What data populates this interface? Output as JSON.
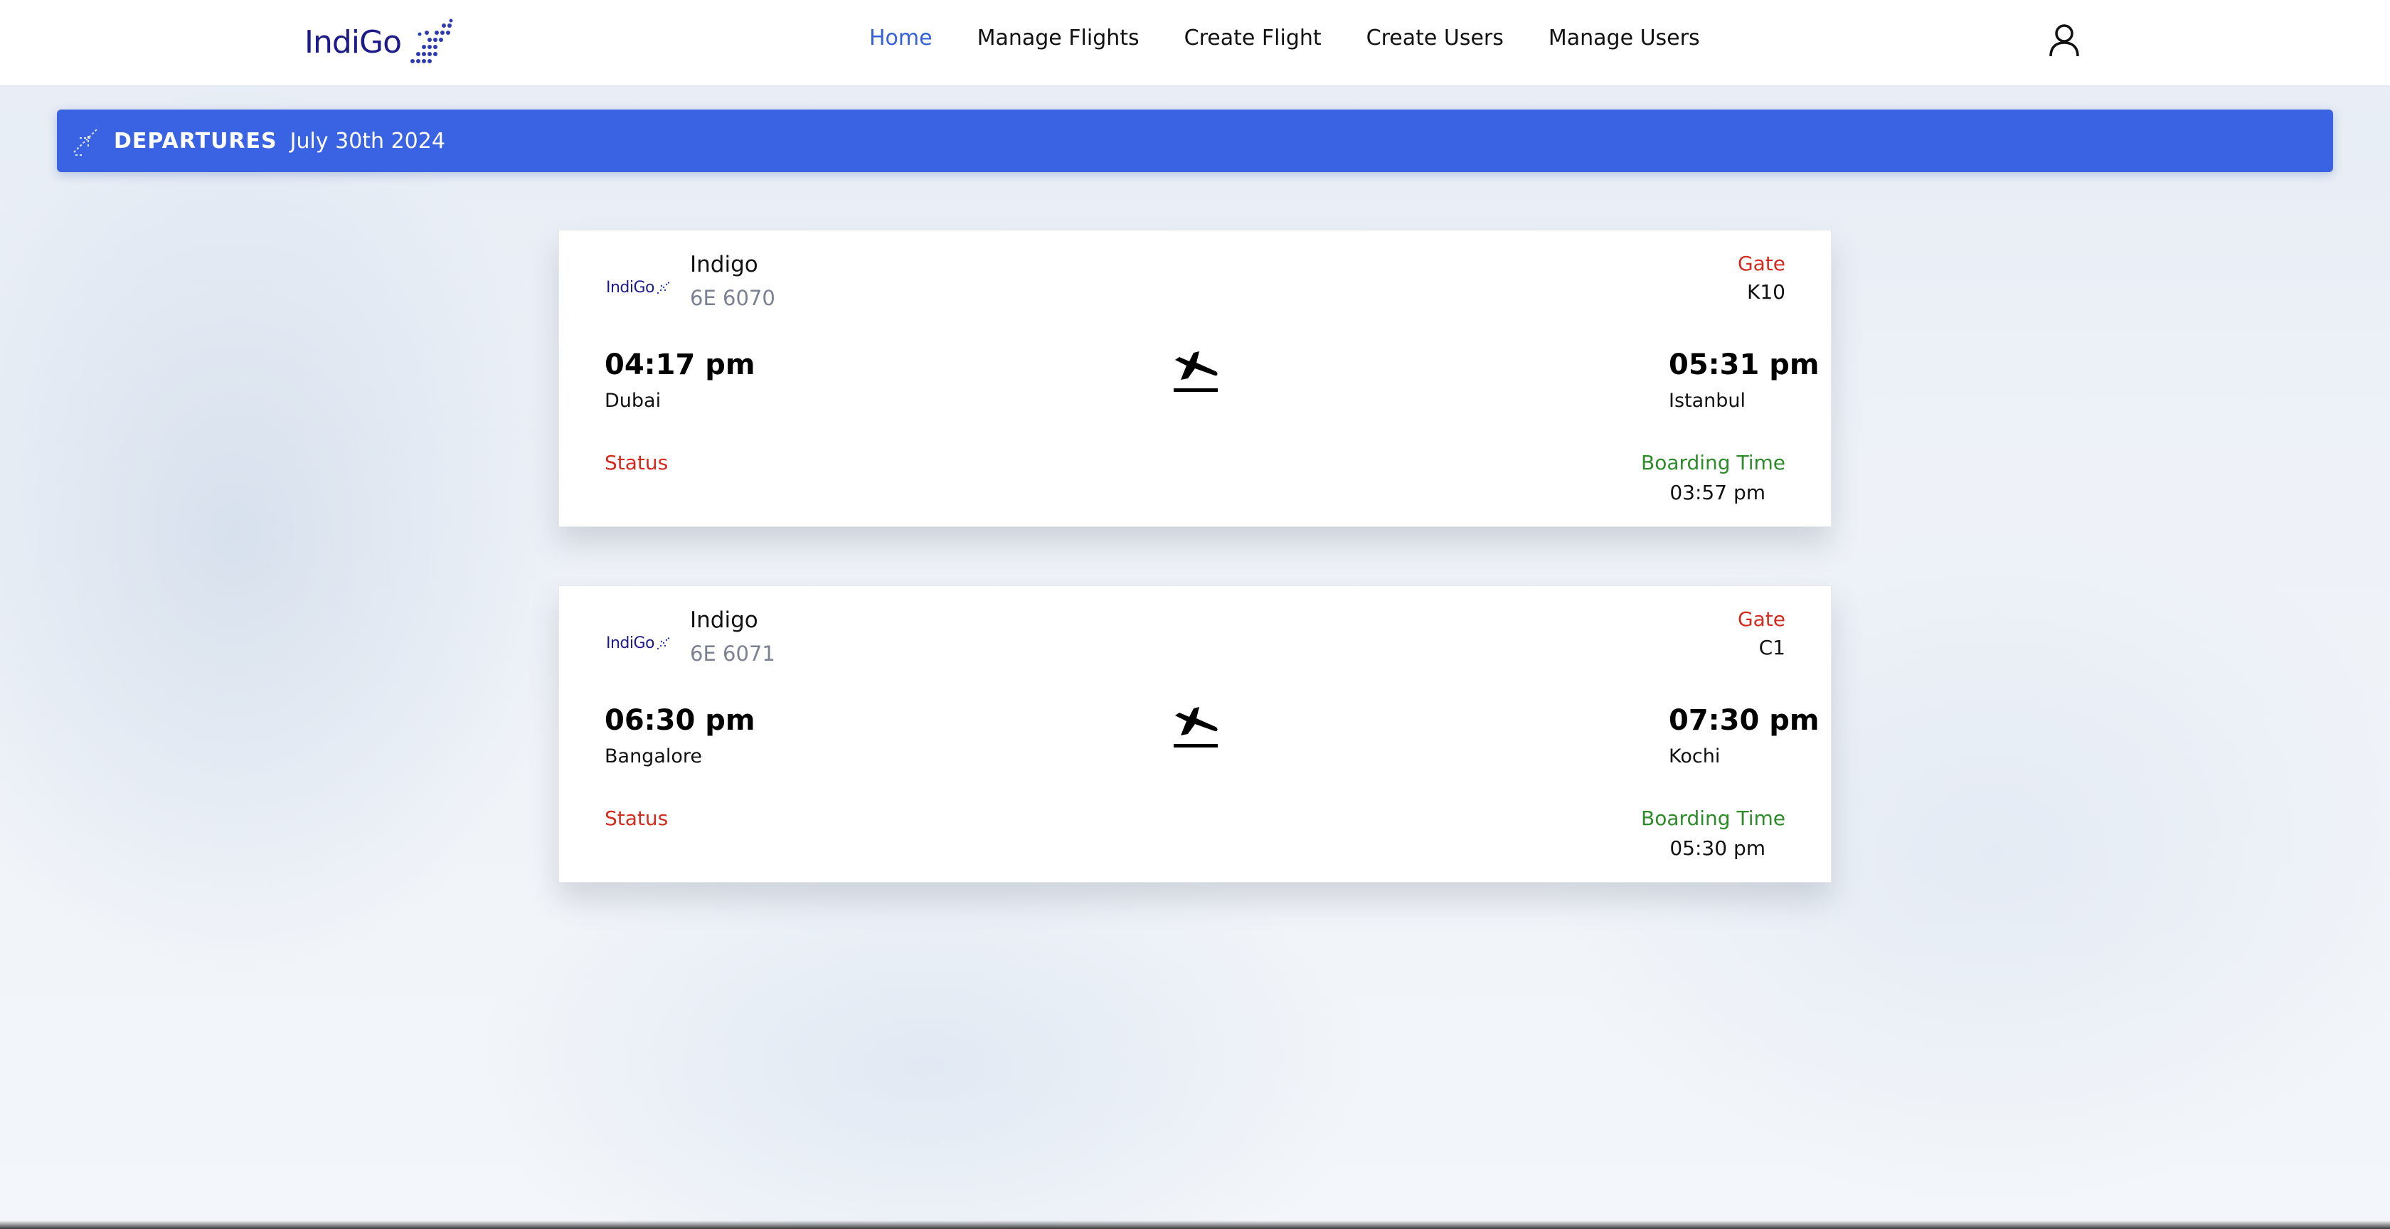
{
  "navbar": {
    "logo_text": "IndiGo",
    "links": [
      {
        "label": "Home",
        "active": true
      },
      {
        "label": "Manage Flights",
        "active": false
      },
      {
        "label": "Create Flight",
        "active": false
      },
      {
        "label": "Create Users",
        "active": false
      },
      {
        "label": "Manage Users",
        "active": false
      }
    ],
    "user_icon": "user-icon"
  },
  "banner": {
    "icon": "takeoff-icon",
    "title": "DEPARTURES",
    "date": "July 30th 2024"
  },
  "flights": [
    {
      "logo_text": "IndiGo",
      "airline": "Indigo",
      "flight_no": "6E 6070",
      "gate_label": "Gate",
      "gate": "K10",
      "departure_time": "04:17 pm",
      "departure_city": "Dubai",
      "arrival_time": "05:31 pm",
      "arrival_city": "Istanbul",
      "status_label": "Status",
      "boarding_label": "Boarding Time",
      "boarding_time": "03:57 pm",
      "icon": "plane-landing-icon"
    },
    {
      "logo_text": "IndiGo",
      "airline": "Indigo",
      "flight_no": "6E 6071",
      "gate_label": "Gate",
      "gate": "C1",
      "departure_time": "06:30 pm",
      "departure_city": "Bangalore",
      "arrival_time": "07:30 pm",
      "arrival_city": "Kochi",
      "status_label": "Status",
      "boarding_label": "Boarding Time",
      "boarding_time": "05:30 pm",
      "icon": "plane-landing-icon"
    }
  ],
  "colors": {
    "brand": "#1d1b8a",
    "nav_active": "#3461d9",
    "banner": "#3a63e3",
    "status_red": "#d42b1f",
    "boarding_green": "#2e8b2a"
  }
}
